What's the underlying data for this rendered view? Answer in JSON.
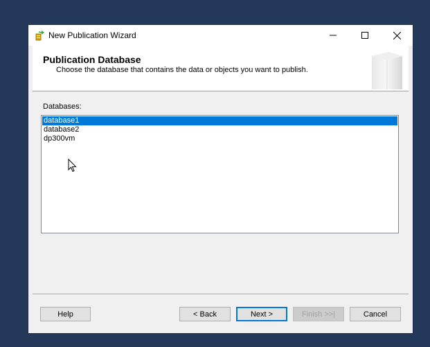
{
  "window": {
    "title": "New Publication Wizard"
  },
  "header": {
    "title": "Publication Database",
    "subtitle": "Choose the database that contains the data or objects you want to publish."
  },
  "databases": {
    "label": "Databases:",
    "items": [
      "database1",
      "database2",
      "dp300vm"
    ],
    "selected": "database1"
  },
  "buttons": {
    "help": "Help",
    "back": "< Back",
    "next": "Next >",
    "finish": "Finish >>|",
    "cancel": "Cancel"
  },
  "colors": {
    "desktop": "#24385a",
    "selection": "#0078d7",
    "default_button_border": "#0078d7"
  }
}
